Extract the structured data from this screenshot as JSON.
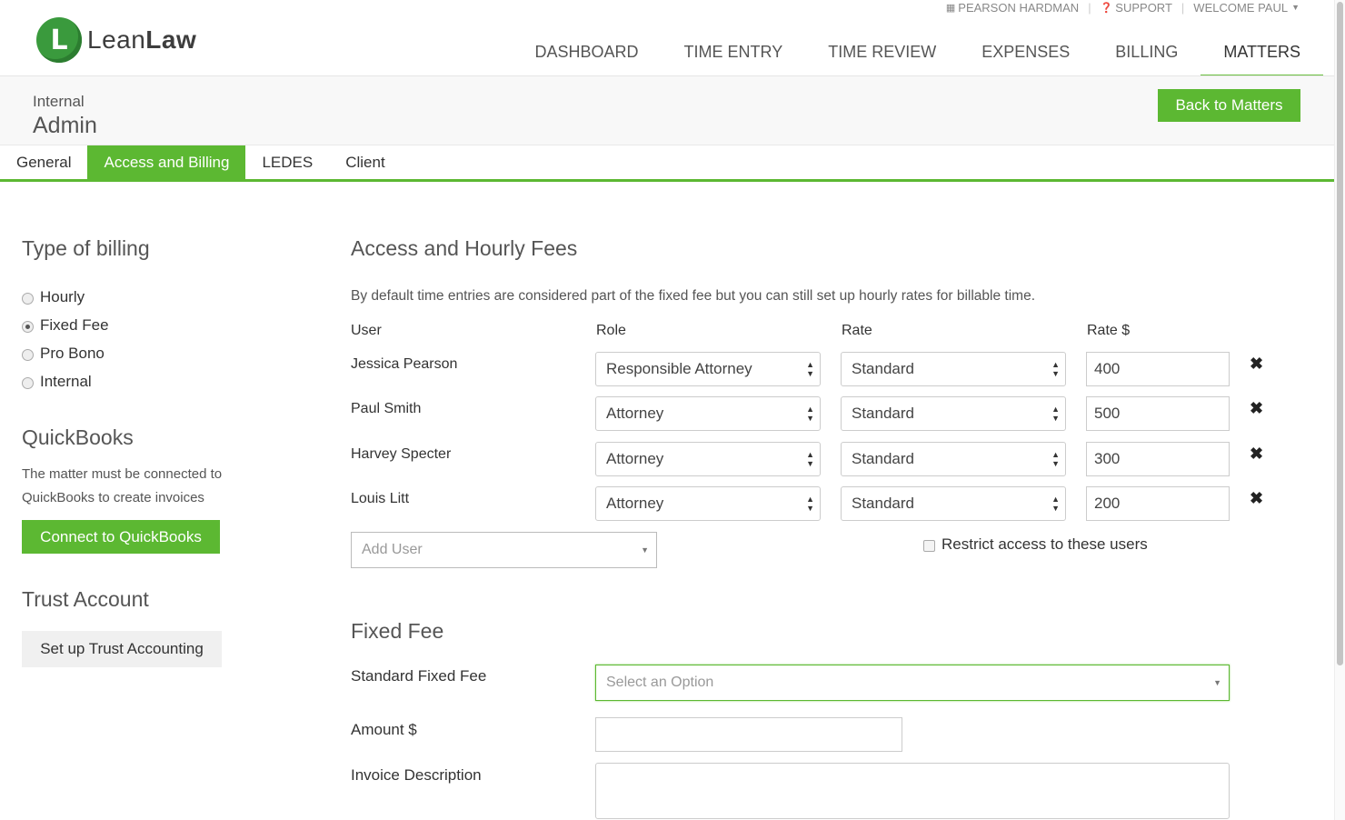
{
  "utility": {
    "firm": "PEARSON HARDMAN",
    "support": "SUPPORT",
    "welcome": "WELCOME PAUL"
  },
  "logo": {
    "mark": "L",
    "text_light": "Lean",
    "text_bold": "Law"
  },
  "nav": [
    "DASHBOARD",
    "TIME ENTRY",
    "TIME REVIEW",
    "EXPENSES",
    "BILLING",
    "MATTERS"
  ],
  "nav_active": "MATTERS",
  "matter": {
    "label": "Internal",
    "title": "Admin",
    "back_button": "Back to Matters"
  },
  "tabs": [
    "General",
    "Access and Billing",
    "LEDES",
    "Client"
  ],
  "tab_active": "Access and Billing",
  "billing": {
    "heading": "Type of billing",
    "options": [
      "Hourly",
      "Fixed Fee",
      "Pro Bono",
      "Internal"
    ],
    "selected": "Fixed Fee"
  },
  "quickbooks": {
    "heading": "QuickBooks",
    "description_line1": "The matter must be connected to",
    "description_line2": "QuickBooks to create invoices",
    "button": "Connect to QuickBooks"
  },
  "trust": {
    "heading": "Trust Account",
    "button": "Set up Trust Accounting"
  },
  "access": {
    "heading": "Access and Hourly Fees",
    "description": "By default time entries are considered part of the fixed fee but you can still set up hourly rates for billable time.",
    "columns": {
      "user": "User",
      "role": "Role",
      "rate": "Rate",
      "rate_amount": "Rate $"
    },
    "rows": [
      {
        "user": "Jessica Pearson",
        "role": "Responsible Attorney",
        "rate": "Standard",
        "amount": "400"
      },
      {
        "user": "Paul Smith",
        "role": "Attorney",
        "rate": "Standard",
        "amount": "500"
      },
      {
        "user": "Harvey Specter",
        "role": "Attorney",
        "rate": "Standard",
        "amount": "300"
      },
      {
        "user": "Louis Litt",
        "role": "Attorney",
        "rate": "Standard",
        "amount": "200"
      }
    ],
    "add_user_placeholder": "Add User",
    "restrict_label": "Restrict access to these users"
  },
  "fixed_fee": {
    "heading": "Fixed Fee",
    "standard_label": "Standard Fixed Fee",
    "standard_placeholder": "Select an Option",
    "amount_label": "Amount $",
    "amount_value": "",
    "invoice_label": "Invoice Description",
    "invoice_value": ""
  },
  "colors": {
    "accent": "#5cb832",
    "logo": "#3a9a3d"
  }
}
